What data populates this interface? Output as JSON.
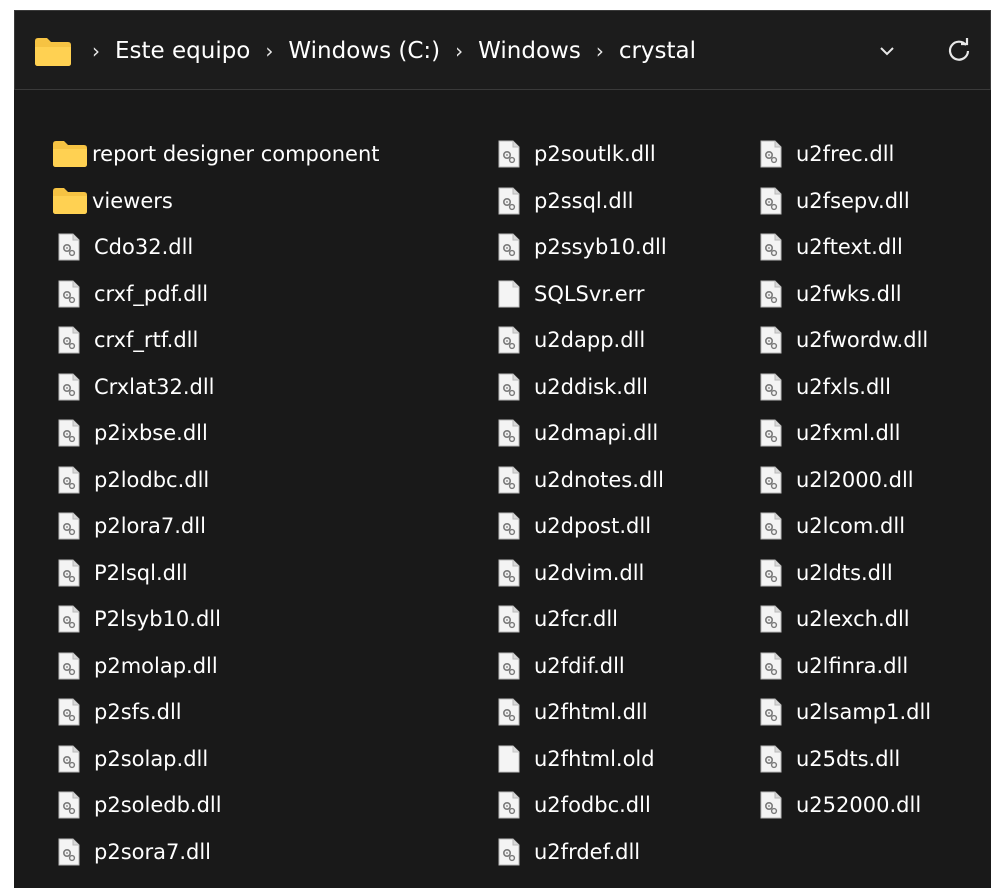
{
  "breadcrumb": {
    "items": [
      "Este equipo",
      "Windows (C:)",
      "Windows",
      "crystal"
    ]
  },
  "colors": {
    "background": "#191919",
    "folder": "#f6c343",
    "text": "#ffffff"
  },
  "files": {
    "columns": [
      [
        {
          "name": "report designer component",
          "type": "folder"
        },
        {
          "name": "viewers",
          "type": "folder"
        },
        {
          "name": "Cdo32.dll",
          "type": "dll"
        },
        {
          "name": "crxf_pdf.dll",
          "type": "dll"
        },
        {
          "name": "crxf_rtf.dll",
          "type": "dll"
        },
        {
          "name": "Crxlat32.dll",
          "type": "dll"
        },
        {
          "name": "p2ixbse.dll",
          "type": "dll"
        },
        {
          "name": "p2lodbc.dll",
          "type": "dll"
        },
        {
          "name": "p2lora7.dll",
          "type": "dll"
        },
        {
          "name": "P2lsql.dll",
          "type": "dll"
        },
        {
          "name": "P2lsyb10.dll",
          "type": "dll"
        },
        {
          "name": "p2molap.dll",
          "type": "dll"
        },
        {
          "name": "p2sfs.dll",
          "type": "dll"
        },
        {
          "name": "p2solap.dll",
          "type": "dll"
        },
        {
          "name": "p2soledb.dll",
          "type": "dll"
        },
        {
          "name": "p2sora7.dll",
          "type": "dll"
        }
      ],
      [
        {
          "name": "p2soutlk.dll",
          "type": "dll"
        },
        {
          "name": "p2ssql.dll",
          "type": "dll"
        },
        {
          "name": "p2ssyb10.dll",
          "type": "dll"
        },
        {
          "name": "SQLSvr.err",
          "type": "file"
        },
        {
          "name": "u2dapp.dll",
          "type": "dll"
        },
        {
          "name": "u2ddisk.dll",
          "type": "dll"
        },
        {
          "name": "u2dmapi.dll",
          "type": "dll"
        },
        {
          "name": "u2dnotes.dll",
          "type": "dll"
        },
        {
          "name": "u2dpost.dll",
          "type": "dll"
        },
        {
          "name": "u2dvim.dll",
          "type": "dll"
        },
        {
          "name": "u2fcr.dll",
          "type": "dll"
        },
        {
          "name": "u2fdif.dll",
          "type": "dll"
        },
        {
          "name": "u2fhtml.dll",
          "type": "dll"
        },
        {
          "name": "u2fhtml.old",
          "type": "file"
        },
        {
          "name": "u2fodbc.dll",
          "type": "dll"
        },
        {
          "name": "u2frdef.dll",
          "type": "dll"
        }
      ],
      [
        {
          "name": "u2frec.dll",
          "type": "dll"
        },
        {
          "name": "u2fsepv.dll",
          "type": "dll"
        },
        {
          "name": "u2ftext.dll",
          "type": "dll"
        },
        {
          "name": "u2fwks.dll",
          "type": "dll"
        },
        {
          "name": "u2fwordw.dll",
          "type": "dll"
        },
        {
          "name": "u2fxls.dll",
          "type": "dll"
        },
        {
          "name": "u2fxml.dll",
          "type": "dll"
        },
        {
          "name": "u2l2000.dll",
          "type": "dll"
        },
        {
          "name": "u2lcom.dll",
          "type": "dll"
        },
        {
          "name": "u2ldts.dll",
          "type": "dll"
        },
        {
          "name": "u2lexch.dll",
          "type": "dll"
        },
        {
          "name": "u2lfinra.dll",
          "type": "dll"
        },
        {
          "name": "u2lsamp1.dll",
          "type": "dll"
        },
        {
          "name": "u25dts.dll",
          "type": "dll"
        },
        {
          "name": "u252000.dll",
          "type": "dll"
        }
      ]
    ]
  }
}
